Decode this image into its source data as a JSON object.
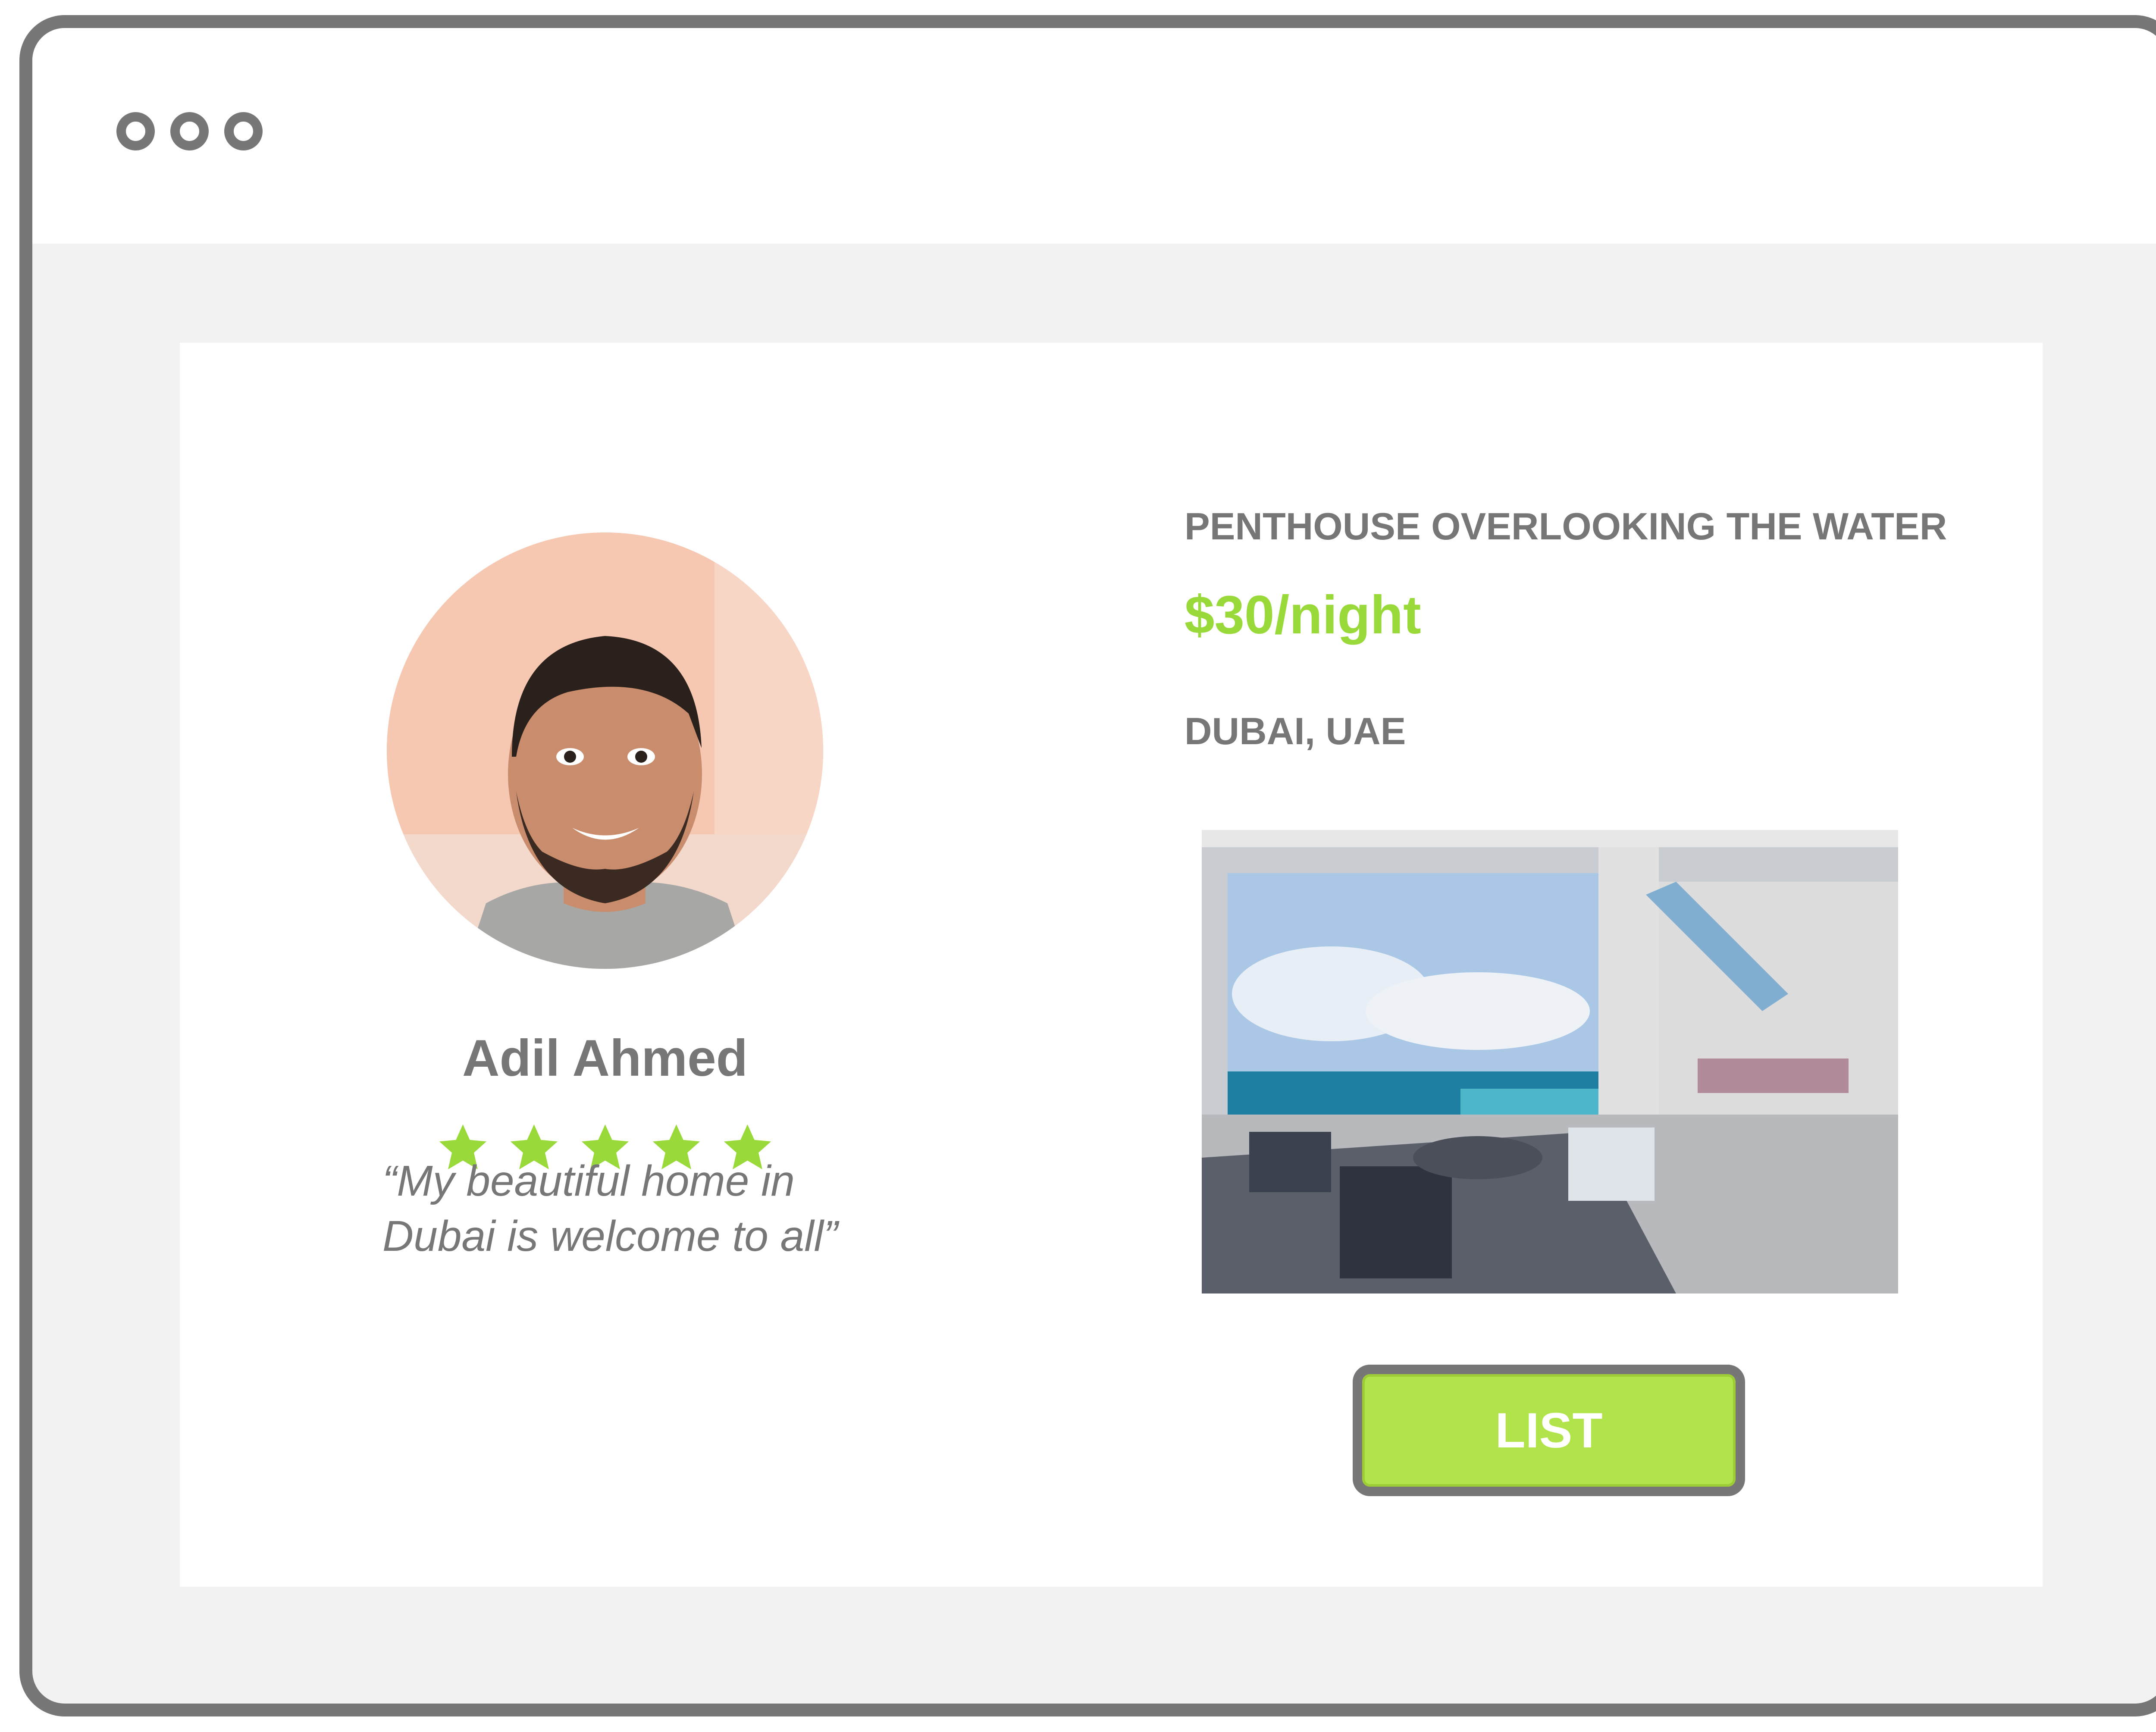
{
  "window": {
    "controls": [
      "window-dot",
      "window-dot",
      "window-dot"
    ]
  },
  "host": {
    "name": "Adil Ahmed",
    "rating": 5,
    "rating_max": 5,
    "quote_line1": "“My beautiful home in",
    "quote_line2": "Dubai is welcome to all”"
  },
  "listing": {
    "title": "PENTHOUSE OVERLOOKING THE WATER",
    "price": "$30/night",
    "location": "DUBAI, UAE",
    "photo_icon": "penthouse-photo"
  },
  "actions": {
    "list_label": "LIST"
  },
  "colors": {
    "accent": "#99d93a",
    "button": "#b1e34a",
    "text": "#777777",
    "frame": "#777777",
    "background": "#f2f2f2"
  }
}
